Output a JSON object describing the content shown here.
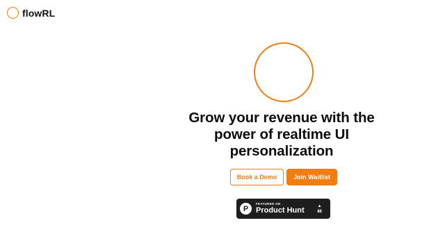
{
  "header": {
    "brand": "flowRL",
    "logo_icon": "ring-logo-icon"
  },
  "hero": {
    "headline": "Grow your revenue with the power of realtime UI personalization",
    "ring_icon": "ring-icon"
  },
  "cta": {
    "book_demo_label": "Book a Demo",
    "join_waitlist_label": "Join Waitlist"
  },
  "product_hunt": {
    "featured_label": "FEATURED ON",
    "name": "Product Hunt",
    "logo_letter": "P",
    "upvote_icon": "▲",
    "votes": "86"
  },
  "colors": {
    "accent": "#f07d12",
    "badge_bg": "#1e1e1e",
    "text": "#0d0d0d"
  }
}
